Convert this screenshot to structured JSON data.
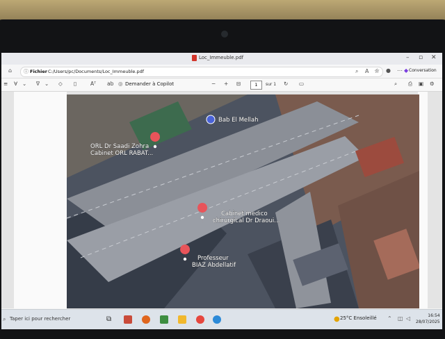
{
  "window": {
    "title": "Loc_Immeuble.pdf"
  },
  "address_bar": {
    "scheme_label": "Fichier",
    "path": "C:/Users/pc/Documents/Loc_Immeuble.pdf"
  },
  "copilot": {
    "label": "Conversation"
  },
  "pdf_toolbar": {
    "ask_copilot": "Demander à Copilot",
    "zoom_out": "−",
    "zoom_in": "+",
    "page_current": "1",
    "page_of": "sur 1"
  },
  "map": {
    "places": [
      {
        "label": "Bab El Mellah"
      },
      {
        "label_line1": "ORL Dr Saadi Zohra",
        "label_line2": "Cabinet ORL RABAT..."
      },
      {
        "label_line1": "Cabinet medico",
        "label_line2": "chirurgical Dr Draoui..."
      },
      {
        "label_line1": "Professeur",
        "label_line2": "BIAZ Abdellatif"
      }
    ]
  },
  "taskbar": {
    "search_placeholder": "Taper ici pour rechercher",
    "weather": "25°C  Ensoleillé",
    "time": "16:54",
    "date": "28/07/2025"
  }
}
